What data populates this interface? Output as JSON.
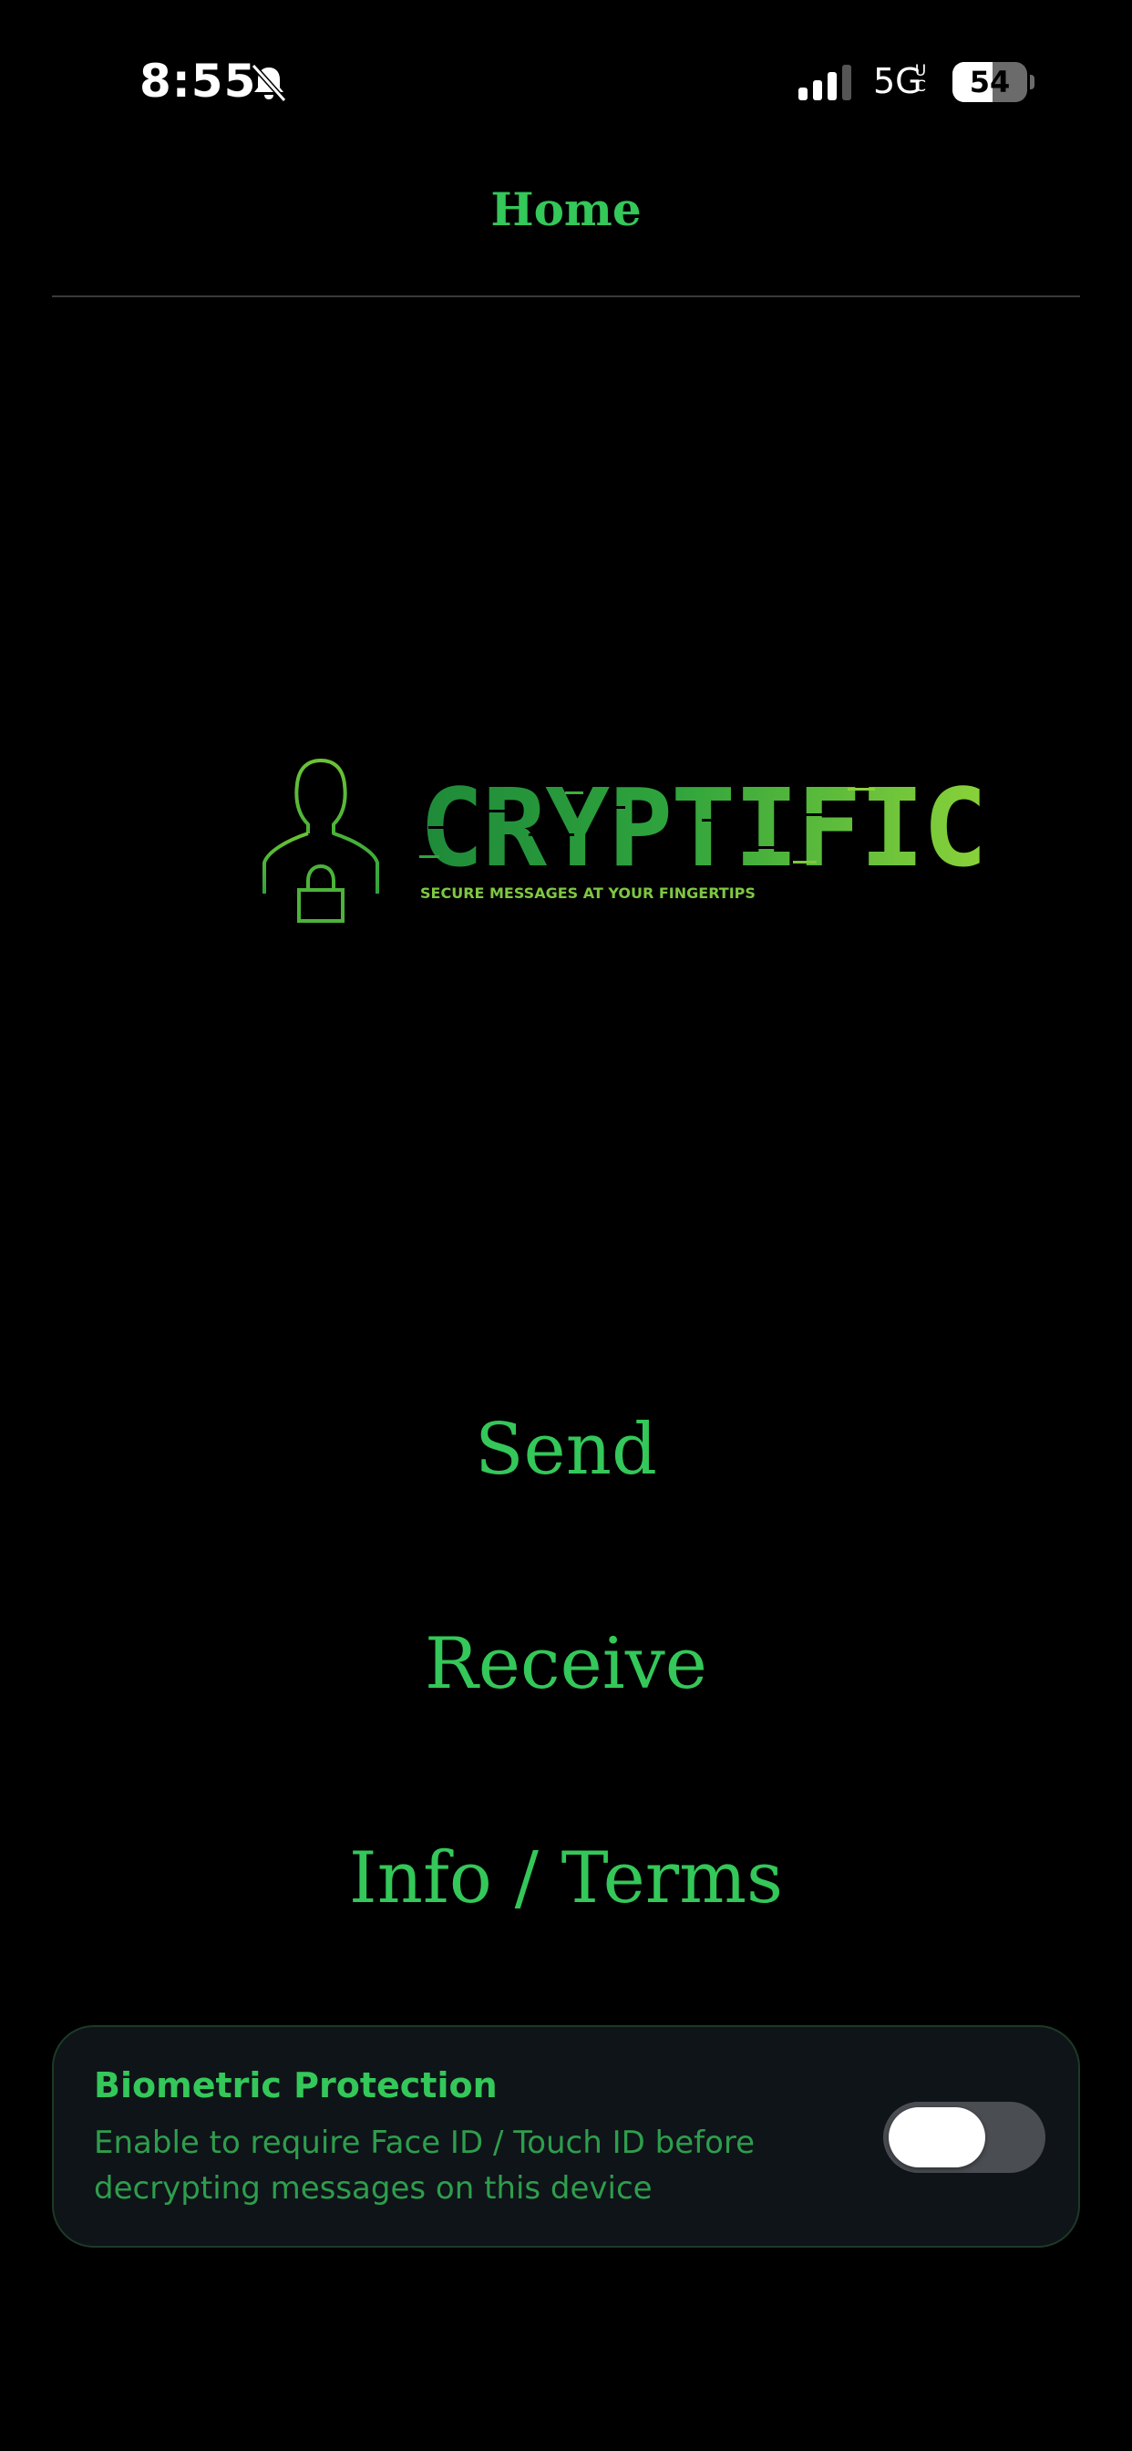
{
  "status_bar": {
    "time": "8:55",
    "network": "5G",
    "network_sup": "UC",
    "battery_percent": 54,
    "battery_label": "54",
    "muted": true
  },
  "nav": {
    "title": "Home"
  },
  "logo": {
    "wordmark": "CRYPTIFIC",
    "tagline": "SECURE MESSAGES AT YOUR FINGERTIPS"
  },
  "menu": {
    "send_label": "Send",
    "receive_label": "Receive",
    "info_label": "Info / Terms"
  },
  "biometric": {
    "title": "Biometric Protection",
    "description": "Enable to require Face ID / Touch ID before decrypting messages on this device",
    "enabled": false
  },
  "colors": {
    "accent": "#34c759",
    "background": "#000000",
    "card": "#0f1419",
    "toggle_off": "#4a4d52"
  },
  "icons": {
    "mute": "bell-slash-icon",
    "signal": "cellular-signal-icon",
    "battery": "battery-icon",
    "logo_figure": "person-lock-icon"
  }
}
